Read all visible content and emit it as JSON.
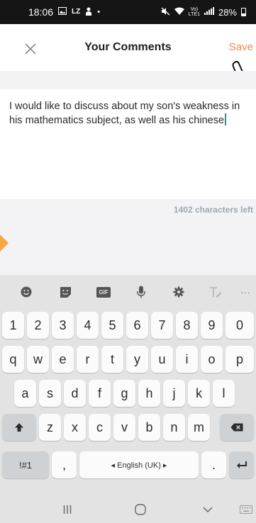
{
  "status_bar": {
    "time": "18:06",
    "icons_left": [
      "image-icon",
      "lz-icon",
      "person-icon",
      "dot-icon"
    ],
    "icons_right": [
      "mute-icon",
      "wifi-icon",
      "volte-icon",
      "signal-icon"
    ],
    "battery_percent": "28%"
  },
  "header": {
    "title": "Your Comments",
    "save_label": "Save",
    "close_icon": "close-icon"
  },
  "comment": {
    "text": "I would like to discuss about my son's weakness in his mathematics subject, as well as his chinese"
  },
  "counter": {
    "text": "1402 characters left"
  },
  "keyboard": {
    "toolbar": [
      "emoji-icon",
      "sticker-icon",
      "gif-icon",
      "mic-icon",
      "settings-icon",
      "text-style-icon",
      "more-icon"
    ],
    "gif_label": "GIF",
    "row_numbers": [
      "1",
      "2",
      "3",
      "4",
      "5",
      "6",
      "7",
      "8",
      "9",
      "0"
    ],
    "row_1": [
      "q",
      "w",
      "e",
      "r",
      "t",
      "y",
      "u",
      "i",
      "o",
      "p"
    ],
    "row_2": [
      "a",
      "s",
      "d",
      "f",
      "g",
      "h",
      "j",
      "k",
      "l"
    ],
    "row_3": [
      "z",
      "x",
      "c",
      "v",
      "b",
      "n",
      "m"
    ],
    "symbols_label": "!#1",
    "comma_label": ",",
    "space_label": "◂ English (UK) ▸",
    "period_label": "."
  },
  "nav_bar": [
    "recents-icon",
    "home-icon",
    "back-icon",
    "keyboard-icon"
  ],
  "colors": {
    "accent": "#f2894a",
    "caret": "#1a9a8f",
    "counter": "#9ea8b3",
    "keyboard_bg": "#e3e3e3"
  }
}
